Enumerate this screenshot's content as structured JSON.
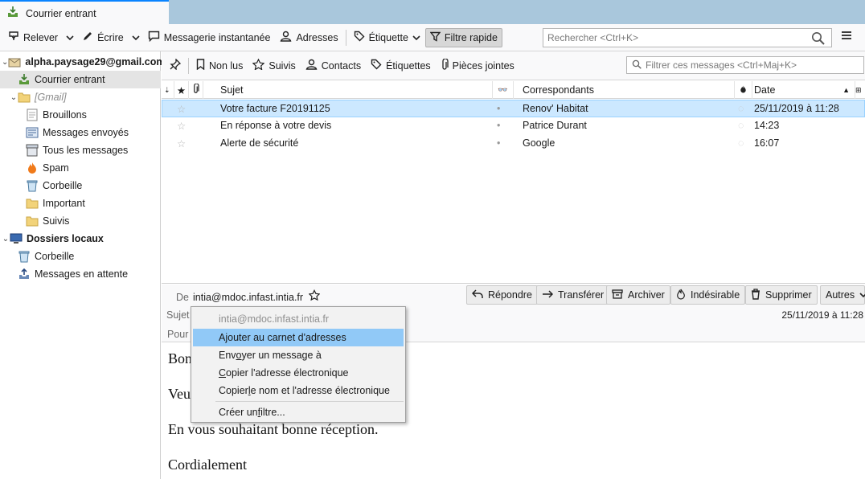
{
  "tab": {
    "title": "Courrier entrant"
  },
  "toolbar": {
    "get_mail": "Relever",
    "write": "Écrire",
    "chat": "Messagerie instantanée",
    "address_book": "Adresses",
    "tag": "Étiquette",
    "quick_filter": "Filtre rapide",
    "search_placeholder": "Rechercher <Ctrl+K>"
  },
  "folders": {
    "account": "alpha.paysage29@gmail.com",
    "inbox": "Courrier entrant",
    "gmail": "[Gmail]",
    "drafts": "Brouillons",
    "sent": "Messages envoyés",
    "all": "Tous les messages",
    "spam": "Spam",
    "trash": "Corbeille",
    "important": "Important",
    "starred": "Suivis",
    "local": "Dossiers locaux",
    "local_trash": "Corbeille",
    "outbox": "Messages en attente"
  },
  "quickfilter": {
    "unread": "Non lus",
    "starred": "Suivis",
    "contacts": "Contacts",
    "tags": "Étiquettes",
    "attachments": "Pièces jointes",
    "filter_placeholder": "Filtrer ces messages <Ctrl+Maj+K>"
  },
  "thread": {
    "columns": {
      "subject": "Sujet",
      "correspondents": "Correspondants",
      "date": "Date"
    },
    "rows": [
      {
        "subject": "Votre facture F20191125",
        "correspondent": "Renov' Habitat",
        "date": "25/11/2019 à 11:28"
      },
      {
        "subject": "En réponse à votre devis",
        "correspondent": "Patrice Durant",
        "date": "14:23"
      },
      {
        "subject": "Alerte de sécurité",
        "correspondent": "Google",
        "date": "16:07"
      }
    ]
  },
  "header": {
    "from_label": "De",
    "from_value": "intia@mdoc.infast.intia.fr",
    "subject_label": "Sujet",
    "to_label": "Pour",
    "date": "25/11/2019 à 11:28",
    "reply": "Répondre",
    "forward": "Transférer",
    "archive": "Archiver",
    "junk": "Indésirable",
    "delete": "Supprimer",
    "more": "Autres"
  },
  "body": {
    "line1": "Bon",
    "line2": "Veu",
    "line3": "En vous souhaitant bonne réception.",
    "line4": "Cordialement"
  },
  "context_menu": {
    "email": "intia@mdoc.infast.intia.fr",
    "add_pre": "A",
    "add_acc": "j",
    "add_post": "outer au carnet d'adresses",
    "send_pre": "Env",
    "send_acc": "o",
    "send_post": "yer un message à",
    "copy_pre": "",
    "copy_acc": "C",
    "copy_post": "opier l'adresse électronique",
    "copyname_pre": "Copier ",
    "copyname_acc": "l",
    "copyname_post": "e nom et l'adresse électronique",
    "filter_pre": "Créer un ",
    "filter_acc": "f",
    "filter_post": "iltre..."
  }
}
